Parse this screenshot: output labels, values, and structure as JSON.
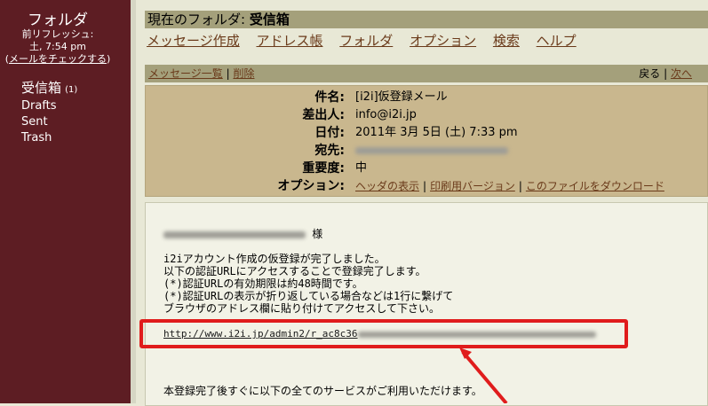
{
  "sidebar": {
    "title": "フォルダ",
    "last_refresh_label": "前リフレッシュ:",
    "last_refresh_time": "土, 7:54 pm",
    "check_mail_open": "(",
    "check_mail": "メールをチェックする",
    "check_mail_close": ")",
    "folders": [
      {
        "name": "受信箱",
        "count": "(1)"
      },
      {
        "name": "Drafts"
      },
      {
        "name": "Sent"
      },
      {
        "name": "Trash"
      }
    ]
  },
  "main": {
    "current_folder_label": "現在のフォルダ:",
    "current_folder": "受信箱",
    "nav": [
      "メッセージ作成",
      "アドレス帳",
      "フォルダ",
      "オプション",
      "検索",
      "ヘルプ"
    ],
    "toolbar": {
      "message_list": "メッセージ一覧",
      "separator": "|",
      "delete": "削除",
      "back": "戻る",
      "next": "次へ"
    },
    "header": {
      "subject_label": "件名:",
      "subject": "[i2i]仮登録メール",
      "from_label": "差出人:",
      "from": "info@i2i.jp",
      "date_label": "日付:",
      "date": "2011年 3月 5日 (土) 7:33 pm",
      "to_label": "宛先:",
      "priority_label": "重要度:",
      "priority": "中",
      "options_label": "オプション:",
      "options": [
        "ヘッダの表示",
        "印刷用バージョン",
        "このファイルをダウンロード"
      ],
      "options_sep": "|"
    },
    "body": {
      "salutation": "様",
      "lines": [
        "i2iアカウント作成の仮登録が完了しました。",
        "以下の認証URLにアクセスすることで登録完了します。",
        "(*)認証URLの有効期限は約48時間です。",
        "(*)認証URLの表示が折り返している場合などは1行に繋げて",
        "ブラウザのアドレス欄に貼り付けてアクセスして下さい。"
      ],
      "url_visible": "http://www.i2i.jp/admin2/r_ac8c36",
      "footer_line": "本登録完了後すぐに以下の全てのサービスがご利用いただけます。"
    }
  },
  "colors": {
    "sidebar_bg": "#5d1d23",
    "bar_bg": "#a4a07b",
    "header_bg": "#c9b78e",
    "link": "#6a3a1a",
    "annotation": "#e01c1c"
  }
}
